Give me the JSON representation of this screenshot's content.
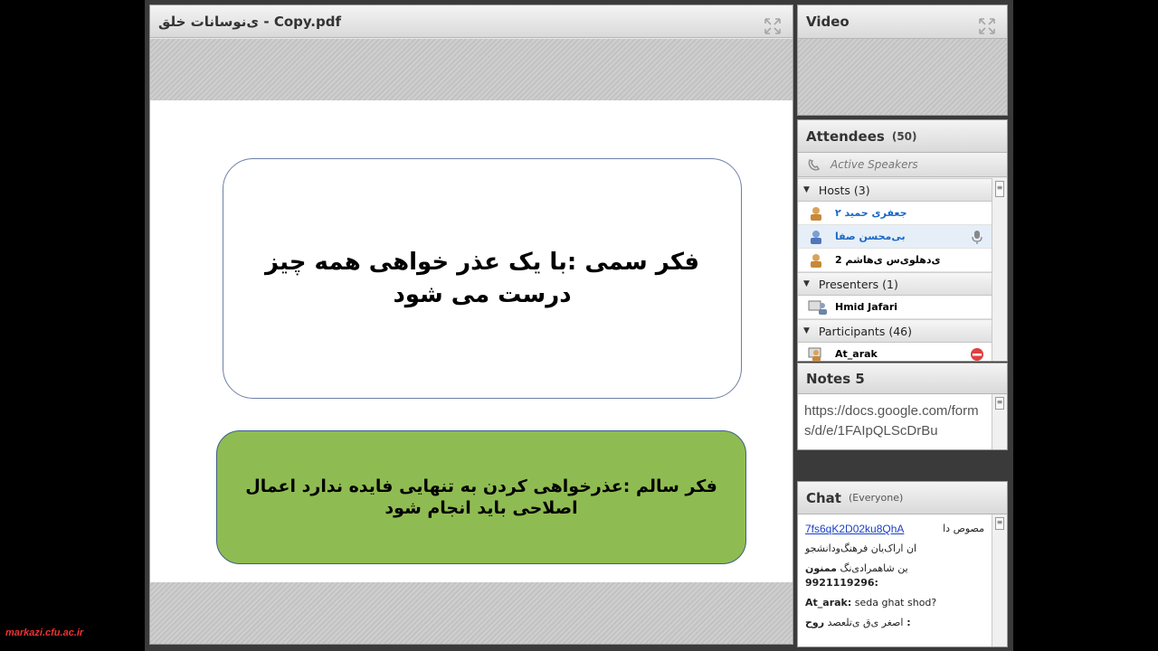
{
  "share_pod": {
    "title": "ی‌نوسانات خلق - Copy.pdf",
    "slide": {
      "box1_text": "فکر سمی :با یک عذر خواهی همه چیز درست می شود",
      "box2_text": "فکر سالم :عذرخواهی کردن به تنهایی فایده ندارد اعمال اصلاحی باید انجام شود",
      "box2_color": "#8fbc52"
    }
  },
  "video_pod": {
    "title": "Video"
  },
  "attendees_pod": {
    "title": "Attendees",
    "count": "(50)",
    "active_speakers": "Active Speakers",
    "hosts": {
      "label": "Hosts (3)",
      "items": [
        {
          "name": "جعفری حمید ۲"
        },
        {
          "name": "بی‌محسن صفا"
        },
        {
          "name": "2 ی‌دهلوی‌س ی‌هاشم"
        }
      ]
    },
    "presenters": {
      "label": "Presenters (1)",
      "items": [
        {
          "name": "Hmid Jafari"
        }
      ]
    },
    "participants": {
      "label": "Participants (46)",
      "items": [
        {
          "name": "At_arak"
        }
      ]
    }
  },
  "notes_pod": {
    "title": "Notes 5",
    "content": "https://docs.google.com/forms/d/e/1FAIpQLScDrBu"
  },
  "chat_pod": {
    "title": "Chat",
    "scope": "(Everyone)",
    "messages": [
      {
        "link": "7fs6qK2D02ku8QhA",
        "text_rtl": "مصوص دا",
        "extra": "ان اراک‌یان فرهنگ‌ودانشجو"
      },
      {
        "sender": "ممنون :9921119296",
        "text": "ین شاهمرادی‌نگ"
      },
      {
        "sender": "At_arak:",
        "text": "seda  ghat  shod?"
      },
      {
        "sender": "روح :",
        "text": "اصغر ی‌ق ی‌تلعصد"
      }
    ]
  },
  "watermark": "markazi.cfu.ac.ir"
}
